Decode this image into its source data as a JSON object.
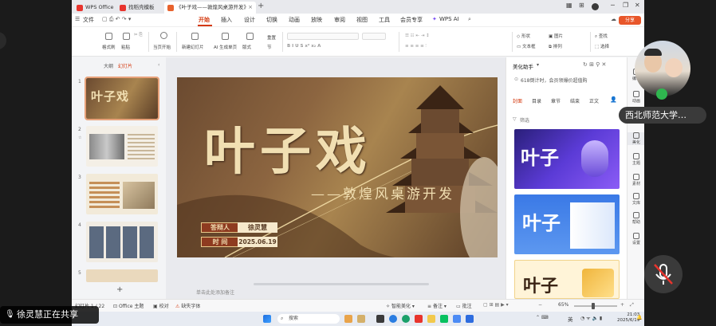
{
  "tabs": [
    {
      "label": "WPS Office",
      "color": "#e8342d"
    },
    {
      "label": "找稻壳模板",
      "color": "#e8342d"
    },
    {
      "label": "《叶子戏——敦煌风桌游开发》",
      "color": "#e8622d"
    }
  ],
  "menu": {
    "file": "文件",
    "items": [
      "开始",
      "插入",
      "设计",
      "切换",
      "动画",
      "放映",
      "审阅",
      "视图",
      "工具",
      "会员专享"
    ],
    "wps_ai": "WPS AI",
    "share": "分享"
  },
  "ribbon": {
    "format_painter": "格式刷",
    "paste": "粘贴",
    "from_current": "当页开始",
    "new_slide": "新建幻灯片",
    "ai_slides": "AI 生成单页",
    "layout": "版式",
    "section": "节",
    "reset": "重置",
    "shape": "形状",
    "picture": "图片",
    "textbox": "文本框",
    "arrange": "排列",
    "find": "查找",
    "select": "选择"
  },
  "left_pane": {
    "tabs": [
      "大纲",
      "幻灯片"
    ],
    "slide_numbers": [
      "1",
      "2",
      "3",
      "4",
      "5"
    ]
  },
  "slide": {
    "title": "叶子戏",
    "subtitle": "——敦煌风桌游开发",
    "reporter_label": "答辩人",
    "reporter_name": "徐灵慧",
    "time_label": "时  间",
    "date": "2025.06.19"
  },
  "thumb1": {
    "title": "叶子戏"
  },
  "notes_placeholder": "单击此处添加备注",
  "beautify": {
    "title": "美化助手",
    "promo": "618倒计时，会员领爆价超值购",
    "tabs": [
      "封面",
      "目录",
      "章节",
      "结束",
      "正文"
    ],
    "filter": "筛选",
    "template_text": [
      "叶子",
      "叶子",
      "叶子"
    ]
  },
  "right_sidebar": [
    "编辑",
    "动画",
    "美化",
    "主题",
    "素材",
    "文库",
    "帮助",
    "设置"
  ],
  "statusbar": {
    "slide_count": "幻灯片 1 / 22",
    "theme": "Office 主题",
    "proofread": "校对",
    "missing_font": "缺失字体",
    "smart_beautify": "智能美化",
    "notes": "备注",
    "comments": "批注",
    "zoom": "65%"
  },
  "taskbar": {
    "search": "搜索",
    "ime": "英",
    "time": "21:03",
    "date": "2025/6/19"
  },
  "meeting": {
    "presenter": "西北师范大学…",
    "sharing": "徐灵慧正在共享"
  },
  "colors": {
    "accent": "#d4380d",
    "slide_gold": "#e8c98a",
    "mic_green": "#2fb64f"
  }
}
